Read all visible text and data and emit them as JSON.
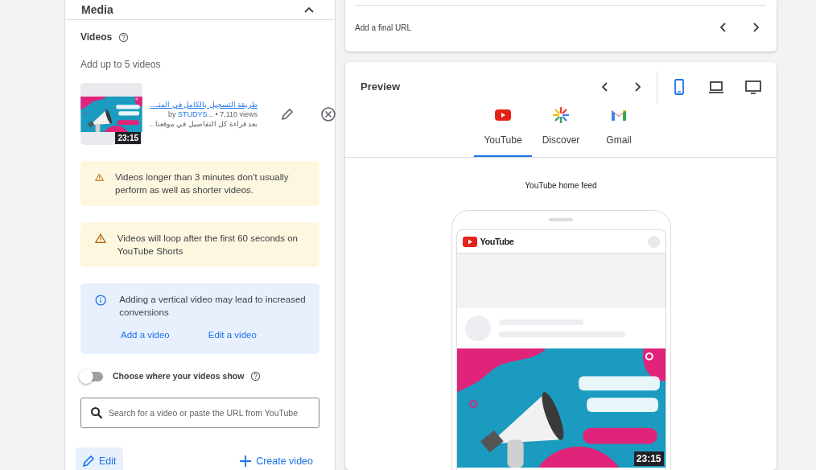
{
  "media_panel": {
    "title": "Media",
    "expanded": true,
    "videos_label": "Videos",
    "hint": "Add up to 5 videos",
    "video": {
      "title": "طريقة التسجيل بالكامل في المنـ...",
      "channel_prefix": "by",
      "channel": "STUDYS...",
      "views": "• 7,110 views",
      "description": "بعد قراءة كل التفاصيل في موقعنا...",
      "duration": "23:15"
    },
    "notices": [
      {
        "kind": "warning",
        "text": "Videos longer than 3 minutes don't usually perform as well as shorter videos."
      },
      {
        "kind": "warning",
        "text": "Videos will loop after the first 60 seconds on YouTube Shorts"
      },
      {
        "kind": "info",
        "text": "Adding a vertical video may lead to increased conversions",
        "links": [
          "Add a video",
          "Edit a video"
        ]
      }
    ],
    "toggle": {
      "label": "Choose where your videos show",
      "on": false
    },
    "search": {
      "placeholder": "Search for a video or paste the URL from YouTube"
    },
    "buttons": [
      {
        "kind": "edit",
        "label": "Edit"
      },
      {
        "kind": "create",
        "label": "Create video"
      }
    ]
  },
  "url_card": {
    "text": "Add a final URL"
  },
  "preview": {
    "title": "Preview",
    "devices": [
      {
        "kind": "mobile",
        "selected": true
      },
      {
        "kind": "laptop",
        "selected": false
      },
      {
        "kind": "desktop",
        "selected": false
      }
    ],
    "tabs": [
      {
        "kind": "youtube",
        "label": "YouTube",
        "selected": true
      },
      {
        "kind": "discover",
        "label": "Discover",
        "selected": false
      },
      {
        "kind": "gmail",
        "label": "Gmail",
        "selected": false
      }
    ],
    "feed_label": "YouTube home feed",
    "app_name": "YouTube",
    "duration": "23:15"
  }
}
